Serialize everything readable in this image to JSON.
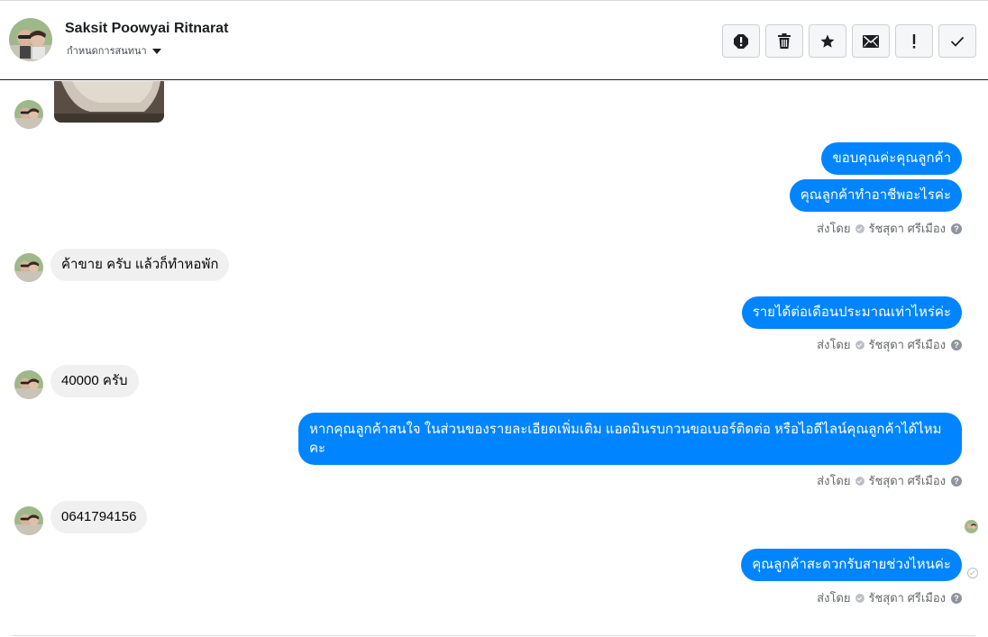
{
  "header": {
    "name": "Saksit Poowyai Ritnarat",
    "subtitle": "กำหนดการสนทนา",
    "actions": [
      {
        "name": "spam-icon",
        "label": "!"
      },
      {
        "name": "trash-icon",
        "label": ""
      },
      {
        "name": "star-icon",
        "label": ""
      },
      {
        "name": "envelope-icon",
        "label": ""
      },
      {
        "name": "important-icon",
        "label": "!"
      },
      {
        "name": "checkmark-icon",
        "label": ""
      }
    ]
  },
  "messages": {
    "out1": "ขอบคุณค่ะคุณลูกค้า",
    "out2": "คุณลูกค้าทำอาชีพอะไรค่ะ",
    "in1": "ค้าขาย ครับ แล้วก็ทำหอพัก",
    "out3": "รายได้ต่อเดือนประมาณเท่าไหร่ค่ะ",
    "in2": "40000 ครับ",
    "out4": "หากคุณลูกค้าสนใจ ในส่วนของรายละเอียดเพิ่มเติม แอดมินรบกวนขอเบอร์ติดต่อ หรือไอดีไลน์คุณลูกค้าได้ไหมคะ",
    "in3": "0641794156",
    "out5": "คุณลูกค้าสะดวกรับสายช่วงไหนค่ะ"
  },
  "sent_by": {
    "prefix": "ส่งโดย",
    "agent": "รัชสุดา ศรีเมือง",
    "help": "?"
  },
  "colors": {
    "outgoing_bubble": "#0084ff",
    "incoming_bubble": "#f0f0f0"
  }
}
